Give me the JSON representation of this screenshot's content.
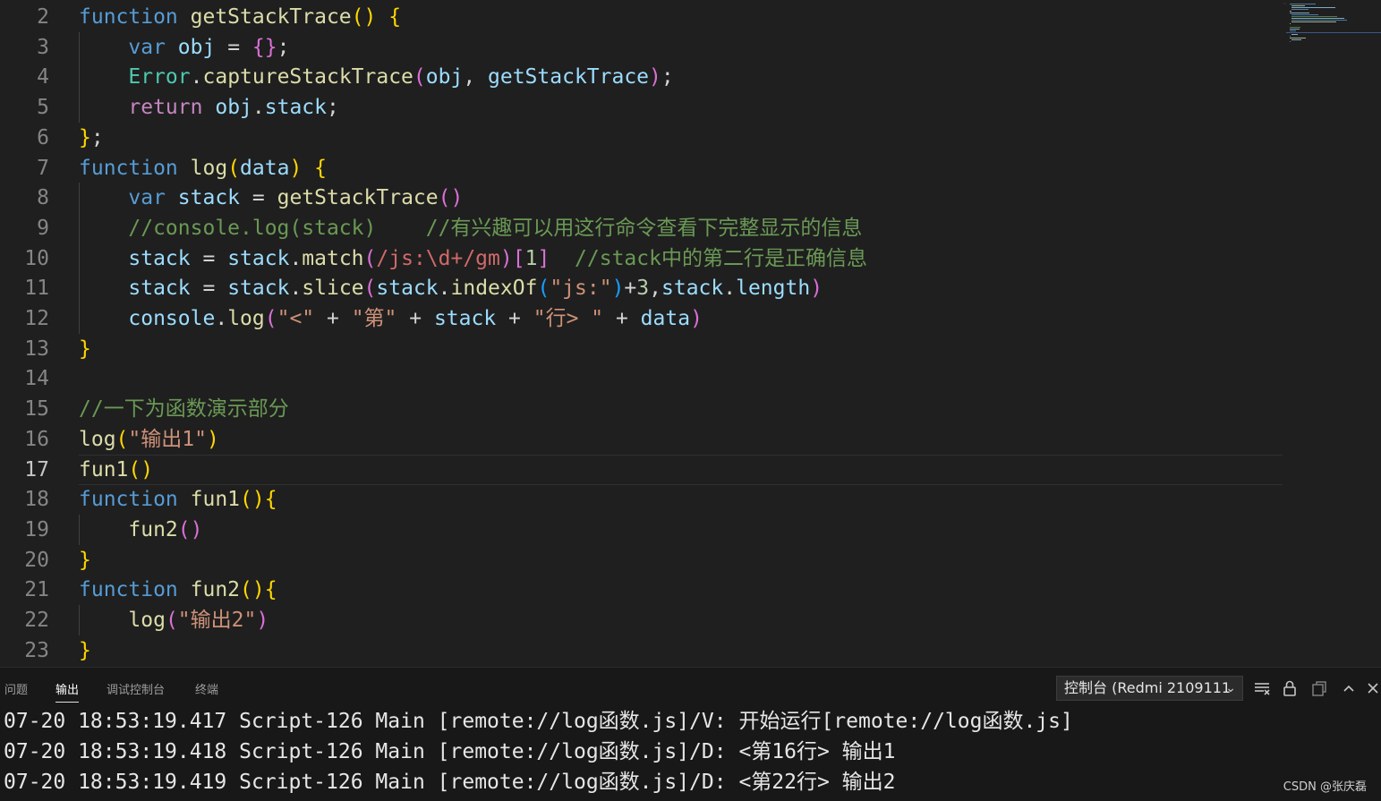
{
  "editor": {
    "language": "javascript",
    "active_line": "17",
    "lines": [
      {
        "n": "2",
        "text": "function getStackTrace() {"
      },
      {
        "n": "3",
        "text": "    var obj = {};"
      },
      {
        "n": "4",
        "text": "    Error.captureStackTrace(obj, getStackTrace);"
      },
      {
        "n": "5",
        "text": "    return obj.stack;"
      },
      {
        "n": "6",
        "text": "};"
      },
      {
        "n": "7",
        "text": "function log(data) {"
      },
      {
        "n": "8",
        "text": "    var stack = getStackTrace()"
      },
      {
        "n": "9",
        "text": "    //console.log(stack)    //有兴趣可以用这行命令查看下完整显示的信息"
      },
      {
        "n": "10",
        "text": "    stack = stack.match(/js:\\d+/gm)[1]  //stack中的第二行是正确信息"
      },
      {
        "n": "11",
        "text": "    stack = stack.slice(stack.indexOf(\"js:\")+3,stack.length)"
      },
      {
        "n": "12",
        "text": "    console.log(\"<\" + \"第\" + stack + \"行> \" + data)"
      },
      {
        "n": "13",
        "text": "}"
      },
      {
        "n": "14",
        "text": ""
      },
      {
        "n": "15",
        "text": "//一下为函数演示部分"
      },
      {
        "n": "16",
        "text": "log(\"输出1\")"
      },
      {
        "n": "17",
        "text": "fun1()"
      },
      {
        "n": "18",
        "text": "function fun1(){"
      },
      {
        "n": "19",
        "text": "    fun2()"
      },
      {
        "n": "20",
        "text": "}"
      },
      {
        "n": "21",
        "text": "function fun2(){"
      },
      {
        "n": "22",
        "text": "    log(\"输出2\")"
      },
      {
        "n": "23",
        "text": "}"
      }
    ]
  },
  "panel": {
    "tabs": [
      {
        "label": "问题",
        "active": false
      },
      {
        "label": "输出",
        "active": true
      },
      {
        "label": "调试控制台",
        "active": false
      },
      {
        "label": "终端",
        "active": false
      }
    ],
    "channel_select": "控制台 (Redmi 2109111",
    "icons": [
      "clear-output-icon",
      "lock-scroll-icon",
      "open-in-editor-icon",
      "maximize-panel-icon",
      "close-panel-icon"
    ],
    "output_lines": [
      "07-20 18:53:19.417 Script-126 Main [remote://log函数.js]/V: 开始运行[remote://log函数.js]",
      "07-20 18:53:19.418 Script-126 Main [remote://log函数.js]/D: <第16行> 输出1",
      "07-20 18:53:19.419 Script-126 Main [remote://log函数.js]/D: <第22行> 输出2"
    ]
  },
  "watermark": "CSDN @张庆磊",
  "colors": {
    "editor_bg": "#1f1f1f",
    "keyword": "#569cd6",
    "function": "#dcdcaa",
    "variable": "#9cdcfe",
    "class": "#4ec9b0",
    "control": "#c586c0",
    "string": "#ce9178",
    "comment": "#6a9955",
    "number": "#b5cea8",
    "bracket_1": "#ffd700",
    "bracket_2": "#da70d6",
    "bracket_3": "#179fff"
  }
}
